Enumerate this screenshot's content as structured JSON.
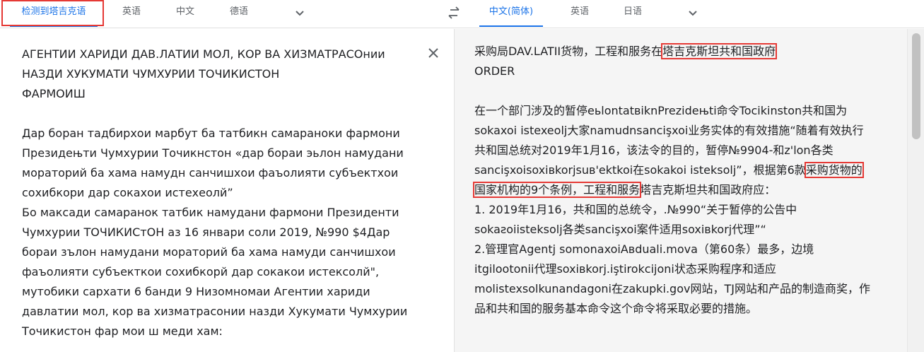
{
  "source_tabs": {
    "detected": "检测到塔吉克语",
    "english": "英语",
    "chinese": "中文",
    "german": "德语"
  },
  "target_tabs": {
    "chinese_simplified": "中文(简体)",
    "english": "英语",
    "japanese": "日语"
  },
  "icons": {
    "swap": "swap-icon",
    "dropdown": "chevron-down-icon",
    "clear": "close-icon"
  },
  "colors": {
    "accent": "#1a73e8",
    "highlight_box": "#e53935"
  },
  "source_text": "АГЕНТИИ ХАРИДИ ДАВ.ЛАТИИ МОЛ, КОР ВА ХИЗМАТРАСОнии\nНАЗДИ ХУКУМАТИ ЧУМХУРИИ ТОЧИКИСТОН\nФАРМОИШ\n\nДар боран тадбирхои марбут ба татбикн самараноки фармони\nПрезидењти Чумхурии Точикнстон «дар бораи эьлон намудани\nмораторий ба хама намудн санчишхои фаъолияти субъектхои\nсохибкори дар сокахои истехеолй”\nБо максади самаранок татбик намудани фармони Президенти\nЧумхурии ТОЧИКИСтОН аз 16 январи соли 2019, №990 $4Дар\nбораи зълон намудани мораторий ба хама намуди санчишхои\nфаъолияти субъекткои сохибкорй дар сокакои истексолй\",\nмутобики сархати 6 банди 9 Низомномаи Агентии хариди\nдавлатии мол, кор ва хизматрасонии назди Хукумати Чумхурии\nТочикистон фар мои ш меди хам:",
  "translation": {
    "line1_pre": "采购局DAV.LATII货物，工程和服务在",
    "line1_hl": "塔吉克斯坦共和国政府",
    "line2": "ORDER",
    "para2_a": "在一个部门涉及的暂停eьlontatвiknPrezideњti命令Tocikinston共和国为sokaxoi istexeolj大家namudnsancişxoi业务实体的有效措施“随着有效执行共和国总统对2019年1月16，该法令的目的，暂停№9904-和z'lon各类sancişxoisoxiвkorjsuв'ektkoi在sokakoi isteksolj”，根据第6款",
    "para2_hl": "采购货物的国家机构的9个条例，工程和服务",
    "para2_b": "塔吉克斯坦共和国政府应：",
    "item1": "1. 2019年1月16，共和国的总统令，.№990“关于暂停的公告中sokaƨoiisteksolj各类sancişxoi案件适用soxiвkorj代理”“",
    "item2": "2.管理官Agentj somonaxoiAвduali.mova（第60条）最多，边境itgilootonii代理soxiвkorj.iştirokcijoni状态采购程序和适应molistexsolkunandagoni在zakupki.gov网站，TJ网站和产品的制造商奖，作品和共和国的服务基本命令这个命令将采取必要的措施。"
  }
}
